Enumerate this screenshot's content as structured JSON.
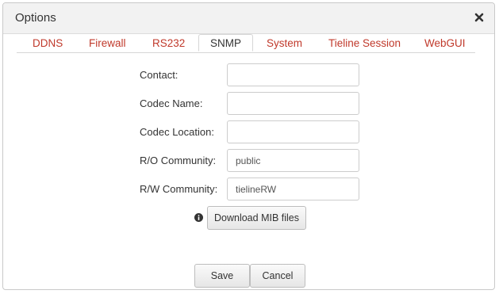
{
  "dialog": {
    "title": "Options",
    "close_icon": "close-icon"
  },
  "tabs": [
    {
      "label": "DDNS",
      "active": false
    },
    {
      "label": "Firewall",
      "active": false
    },
    {
      "label": "RS232",
      "active": false
    },
    {
      "label": "SNMP",
      "active": true
    },
    {
      "label": "System",
      "active": false
    },
    {
      "label": "Tieline Session",
      "active": false
    },
    {
      "label": "WebGUI",
      "active": false
    }
  ],
  "form": {
    "contact": {
      "label": "Contact:",
      "value": ""
    },
    "codec_name": {
      "label": "Codec Name:",
      "value": ""
    },
    "codec_location": {
      "label": "Codec Location:",
      "value": ""
    },
    "ro_community": {
      "label": "R/O Community:",
      "value": "public"
    },
    "rw_community": {
      "label": "R/W Community:",
      "value": "tielineRW"
    }
  },
  "mib": {
    "info_icon": "info-circle-icon",
    "download_label": "Download MIB files"
  },
  "footer": {
    "save_label": "Save",
    "cancel_label": "Cancel"
  },
  "colors": {
    "tab_inactive": "#c0392b",
    "title_bar": "#f2f2f2"
  }
}
